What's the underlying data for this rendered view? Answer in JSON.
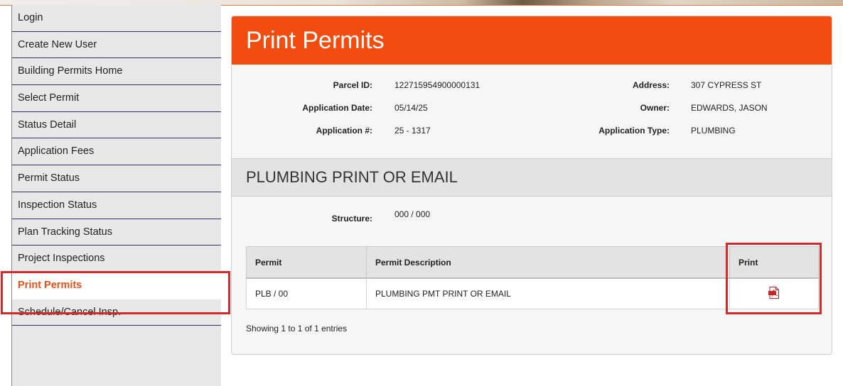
{
  "sidebar": {
    "items": [
      {
        "label": "Login"
      },
      {
        "label": "Create New User"
      },
      {
        "label": "Building Permits Home"
      },
      {
        "label": "Select Permit"
      },
      {
        "label": "Status Detail"
      },
      {
        "label": "Application Fees"
      },
      {
        "label": "Permit Status"
      },
      {
        "label": "Inspection Status"
      },
      {
        "label": "Plan Tracking Status"
      },
      {
        "label": "Project Inspections"
      },
      {
        "label": "Print Permits"
      },
      {
        "label": "Schedule/Cancel Insp."
      }
    ],
    "active_item": "Print Permits"
  },
  "page": {
    "title": "Print Permits",
    "accent_color": "#f24c0f",
    "highlight_color": "#d62a2a"
  },
  "info": {
    "parcel_id_label": "Parcel ID:",
    "parcel_id": "122715954900000131",
    "application_date_label": "Application Date:",
    "application_date": "05/14/25",
    "application_no_label": "Application #:",
    "application_no": "25 - 1317",
    "address_label": "Address:",
    "address": "307 CYPRESS ST",
    "owner_label": "Owner:",
    "owner": "EDWARDS, JASON",
    "application_type_label": "Application Type:",
    "application_type": "PLUMBING"
  },
  "section": {
    "title": "PLUMBING PRINT OR EMAIL",
    "structure_label": "Structure:",
    "structure_value": "000 / 000"
  },
  "table": {
    "headers": [
      "Permit",
      "Permit Description",
      "Print"
    ],
    "rows": [
      {
        "permit": "PLB / 00",
        "description": "PLUMBING PMT PRINT OR EMAIL",
        "print_icon": "pdf-icon"
      }
    ],
    "footer": "Showing 1 to 1 of 1 entries"
  }
}
